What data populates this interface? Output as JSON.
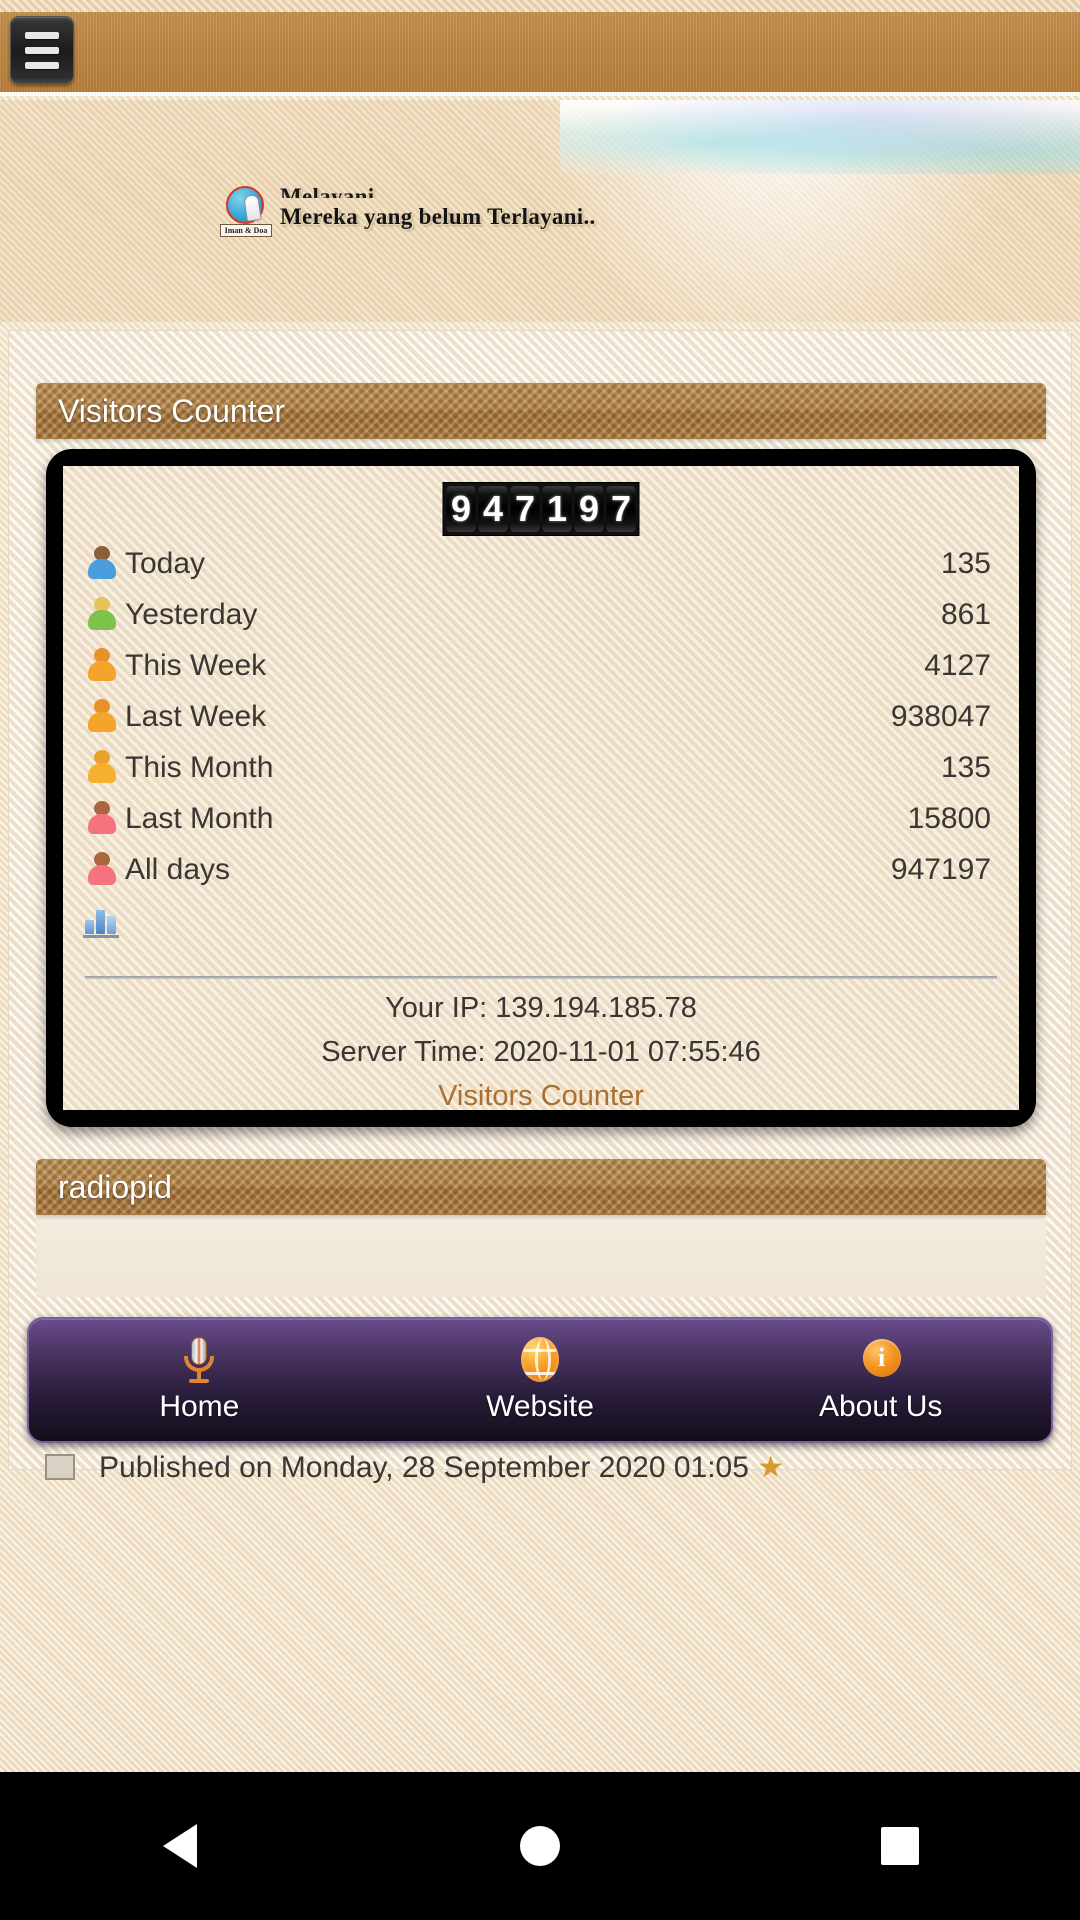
{
  "appbar": {
    "menu_button_label": "Menu"
  },
  "banner": {
    "logo_caption": "Iman & Doa",
    "line1": "Melayani...",
    "line2": "Mereka yang belum Terlayani.."
  },
  "modules": {
    "visitors": {
      "title": "Visitors Counter",
      "odometer_digits": [
        "9",
        "4",
        "7",
        "1",
        "9",
        "7"
      ],
      "stats": [
        {
          "icon": "person-blue-icon",
          "label": "Today",
          "value": "135",
          "head_color": "#8a5f3c",
          "body_color": "#4a9ede"
        },
        {
          "icon": "person-green-icon",
          "label": "Yesterday",
          "value": "861",
          "head_color": "#e8c35a",
          "body_color": "#7dc24a"
        },
        {
          "icon": "person-orange-icon",
          "label": "This Week",
          "value": "4127",
          "head_color": "#e8912a",
          "body_color": "#f4a32b"
        },
        {
          "icon": "person-orange2-icon",
          "label": "Last Week",
          "value": "938047",
          "head_color": "#e8912a",
          "body_color": "#f4a32b"
        },
        {
          "icon": "person-amber-icon",
          "label": "This Month",
          "value": "135",
          "head_color": "#e8a22a",
          "body_color": "#f7b02d"
        },
        {
          "icon": "person-pink-icon",
          "label": "Last Month",
          "value": "15800",
          "head_color": "#a9663f",
          "body_color": "#f5737f"
        },
        {
          "icon": "person-pink2-icon",
          "label": "All days",
          "value": "947197",
          "head_color": "#a9663f",
          "body_color": "#f5737f"
        }
      ],
      "chart_icon": "bar-chart-icon",
      "footer": {
        "ip": "Your IP: 139.194.185.78",
        "server_time": "Server Time: 2020-11-01 07:55:46",
        "link": "Visitors Counter"
      }
    },
    "radiopid": {
      "title": "radiopid"
    }
  },
  "bottom_nav": {
    "items": [
      {
        "icon": "microphone-icon",
        "label": "Home"
      },
      {
        "icon": "globe-icon",
        "label": "Website"
      },
      {
        "icon": "info-icon",
        "label": "About Us"
      }
    ]
  },
  "partial_row": {
    "text": "Published on Monday, 28 September 2020 01:05",
    "star": "★"
  },
  "system_bar": {
    "back": "back-button",
    "home": "home-button",
    "recents": "recents-button"
  },
  "colors": {
    "appbar_brown": "#bf8945",
    "module_header_brown": "#bb8747",
    "page_cream": "#f4eadb",
    "nav_purple": "#4a3463",
    "link_brown": "#ab6f2e"
  }
}
